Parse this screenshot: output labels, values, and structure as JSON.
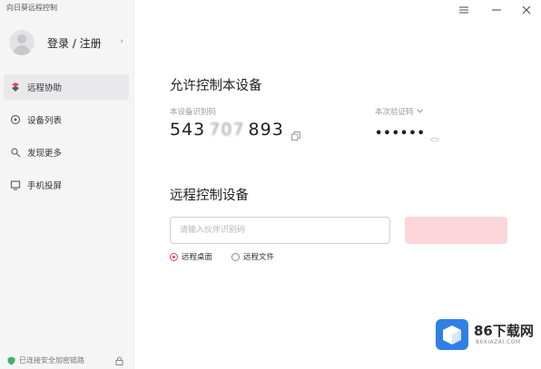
{
  "app": {
    "title": "向日葵远程控制"
  },
  "user": {
    "login_label": "登录 / 注册",
    "chevron": "›"
  },
  "sidebar": {
    "items": [
      {
        "label": "远程协助",
        "icon": "remote-assist-icon",
        "active": true
      },
      {
        "label": "设备列表",
        "icon": "device-list-icon",
        "active": false
      },
      {
        "label": "发现更多",
        "icon": "discover-icon",
        "active": false
      },
      {
        "label": "手机投屏",
        "icon": "screen-cast-icon",
        "active": false
      }
    ],
    "footer_status": "已连接安全加密链路"
  },
  "allow_control": {
    "title": "允许控制本设备",
    "id_label": "本设备识别码",
    "id_prefix": "543",
    "id_masked": "707",
    "id_suffix": "893",
    "password_label": "本次验证码",
    "password_value": "••••••"
  },
  "remote_control": {
    "title": "远程控制设备",
    "input_placeholder": "请输入伙伴识别码",
    "connect_label": "",
    "options": [
      {
        "label": "远程桌面",
        "checked": true
      },
      {
        "label": "远程文件",
        "checked": false
      }
    ]
  },
  "watermark": {
    "text": "86下载网",
    "url": "86XIAZAI.COM"
  },
  "colors": {
    "accent": "#e24a5b",
    "connect_disabled": "#fbd6da",
    "sidebar_bg": "#f5f5f6"
  }
}
